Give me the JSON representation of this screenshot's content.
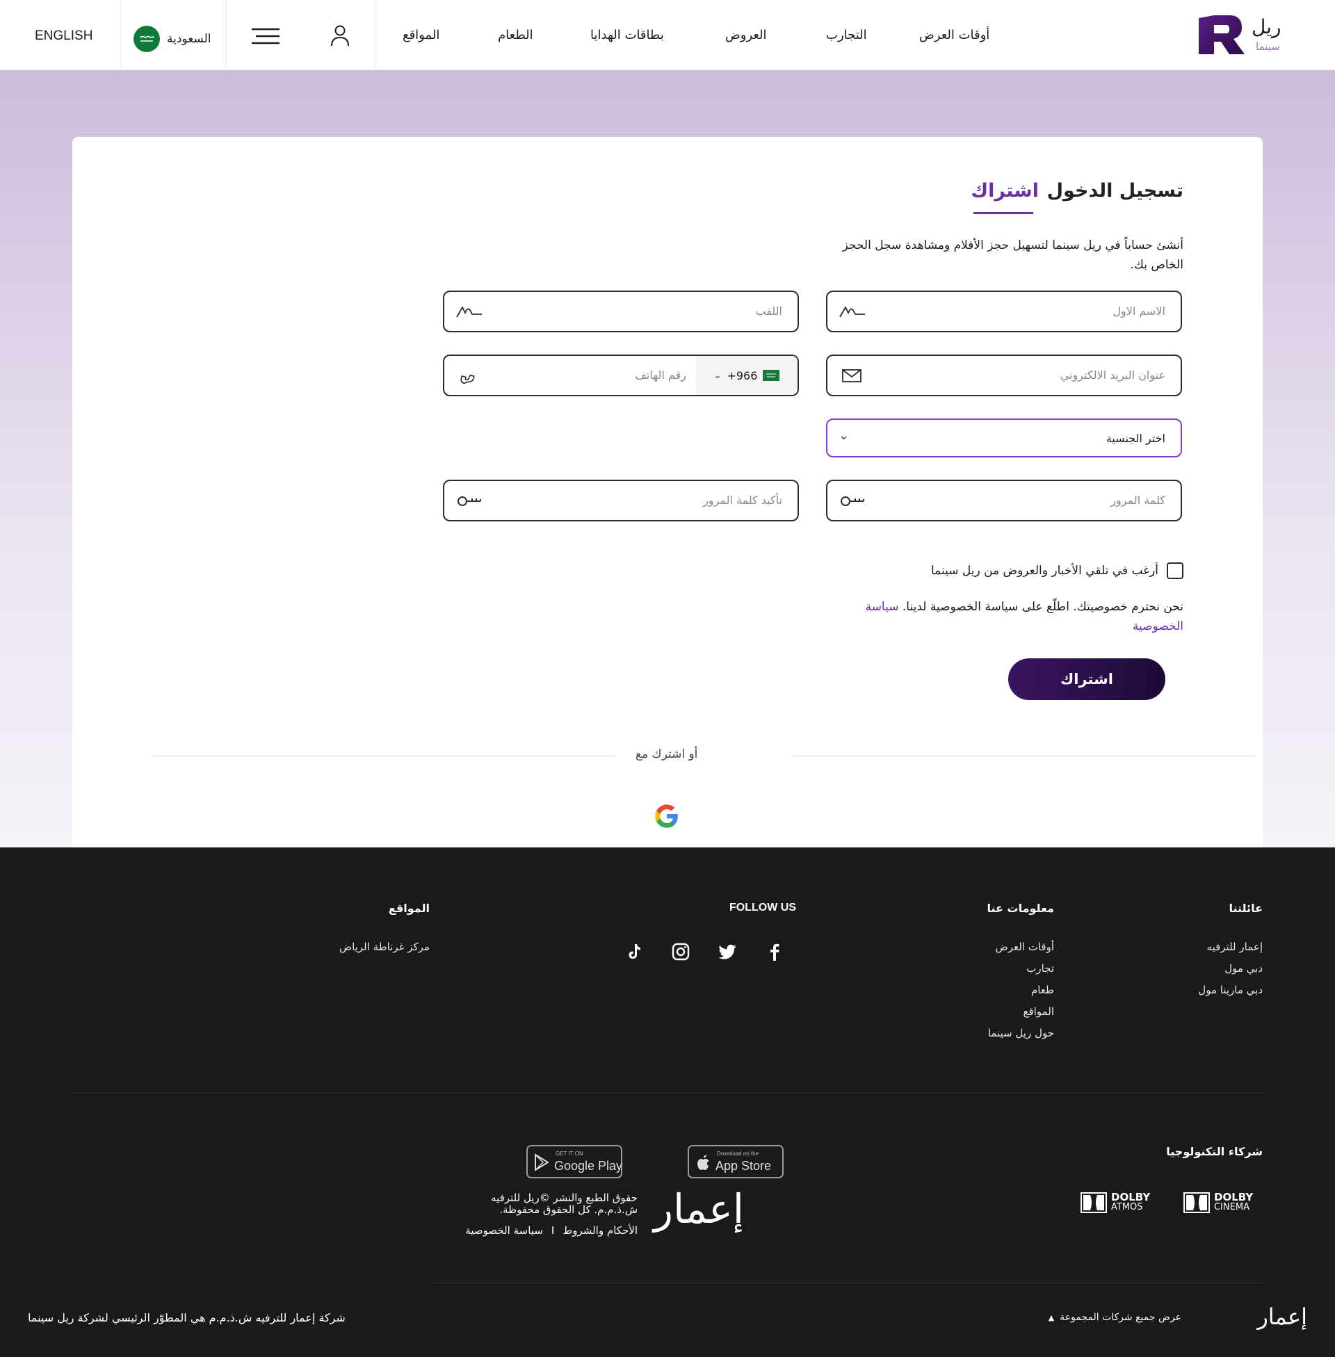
{
  "header": {
    "logo": {
      "name_ar": "ريل",
      "sub_ar": "سينما"
    },
    "nav": [
      "أوقات العرض",
      "التجارب",
      "العروض",
      "بطاقات الهدايا",
      "الطعام",
      "المواقع"
    ],
    "country": "السعودية",
    "language": "ENGLISH"
  },
  "tabs": {
    "login": "تسجيل الدخول",
    "signup": "اشتراك"
  },
  "intro": "أنشئ حساباً في ريل سينما لتسهيل حجز الأفلام ومشاهدة سجل الحجز الخاص بك.",
  "form": {
    "first_name": "الاسم الاول",
    "last_name": "اللقب",
    "email": "عنوان البريد الالكتروني",
    "phone": "رقم الهاتف",
    "phone_code": "+966",
    "nationality": "اختر الجنسية",
    "password": "كلمة المرور",
    "confirm_password": "تأكيد كلمة المرور",
    "newsletter": "أرغب في تلقي الأخبار والعروض من ريل سينما",
    "privacy_text": "نحن نحترم خصوصيتك. اطلّع على سياسة الخصوصية لدينا. ",
    "privacy_link": "سياسة الخصوصية",
    "submit": "اشتراك",
    "or_signup_with": "أو اشترك مع"
  },
  "footer": {
    "family": {
      "title": "عائلتنا",
      "items": [
        "إعمار للترفيه",
        "دبي مول",
        "دبي مارينا مول"
      ]
    },
    "about": {
      "title": "معلومات عنا",
      "items": [
        "أوقات العرض",
        "تجارب",
        "طعام",
        "المواقع",
        "حول ريل سينما"
      ]
    },
    "follow_title": "FOLLOW US",
    "social": [
      "facebook-icon",
      "twitter-icon",
      "instagram-icon",
      "tiktok-icon"
    ],
    "locations": {
      "title": "المواقع",
      "items": [
        "مركز غرناطة الرياض"
      ]
    },
    "tech_partners": "شركاء التكنولوجيا",
    "dolby": [
      {
        "top": "DOLBY",
        "bottom": "CINEMA"
      },
      {
        "top": "DOLBY",
        "bottom": "ATMOS"
      }
    ],
    "app_store": {
      "small": "Download on the",
      "big": "App Store"
    },
    "google_play": {
      "small": "GET IT ON",
      "big": "Google Play"
    },
    "emaar_logo": "إعمار",
    "copyright": "حقوق الطبع والنشر ©ريل للترفيه ش.ذ.م.م. كل الحقوق محفوظة.",
    "terms": "الأحكام والشروط",
    "separator": "I",
    "privacy": "سياسة الخصوصية",
    "group_companies": "عرض جميع شركات المجموعة",
    "developer_note": "شركة إعمار للترفيه ش.ذ.م.م هي المطوّر الرئيسي لشركة ريل سينما"
  },
  "colors": {
    "accent": "#6b2ea8",
    "button_dark": "#2a0f4a",
    "footer_bg": "#1b1a1b"
  }
}
